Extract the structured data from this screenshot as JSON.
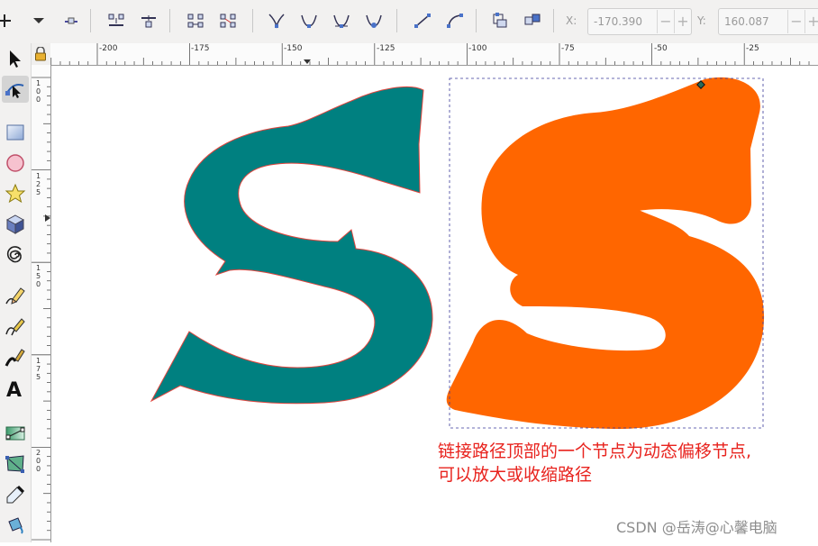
{
  "toolbar": {
    "buttons": [
      {
        "name": "add-node-icon"
      },
      {
        "name": "dropdown-arrow-icon"
      },
      {
        "name": "delete-node-icon"
      },
      {
        "name": "join-nodes-icon"
      },
      {
        "name": "break-path-icon"
      },
      {
        "name": "join-segment-icon"
      },
      {
        "name": "delete-segment-icon"
      },
      {
        "name": "node-cusp-icon"
      },
      {
        "name": "node-smooth-icon"
      },
      {
        "name": "node-symmetric-icon"
      },
      {
        "name": "node-auto-icon"
      },
      {
        "name": "segment-line-icon"
      },
      {
        "name": "segment-curve-icon"
      },
      {
        "name": "object-to-path-icon"
      },
      {
        "name": "stroke-to-path-icon"
      }
    ],
    "x_label": "X:",
    "x_value": "-170.390",
    "y_label": "Y:",
    "y_value": "160.087"
  },
  "ruler": {
    "h_labels": [
      "-200",
      "-175",
      "-150",
      "-125",
      "-100",
      "-75",
      "-50",
      "-25"
    ],
    "v_labels": [
      "100",
      "125",
      "150",
      "175",
      "200"
    ]
  },
  "tools": [
    {
      "name": "selector-tool-icon"
    },
    {
      "name": "node-tool-icon"
    },
    {
      "name": "rectangle-tool-icon"
    },
    {
      "name": "ellipse-tool-icon"
    },
    {
      "name": "star-tool-icon"
    },
    {
      "name": "3d-box-tool-icon"
    },
    {
      "name": "spiral-tool-icon"
    },
    {
      "name": "pencil-tool-icon"
    },
    {
      "name": "pen-tool-icon"
    },
    {
      "name": "calligraphy-tool-icon"
    },
    {
      "name": "text-tool-icon"
    },
    {
      "name": "gradient-tool-icon"
    },
    {
      "name": "mesh-tool-icon"
    },
    {
      "name": "dropper-tool-icon"
    },
    {
      "name": "paint-bucket-tool-icon"
    }
  ],
  "canvas": {
    "shape_colors": {
      "teal": "#008080",
      "orange": "#ff6600",
      "outline": "#e0463f"
    },
    "annotation_line1": "链接路径顶部的一个节点为动态偏移节点,",
    "annotation_line2": "可以放大或收缩路径"
  },
  "watermark": "CSDN @岳涛@心馨电脑"
}
